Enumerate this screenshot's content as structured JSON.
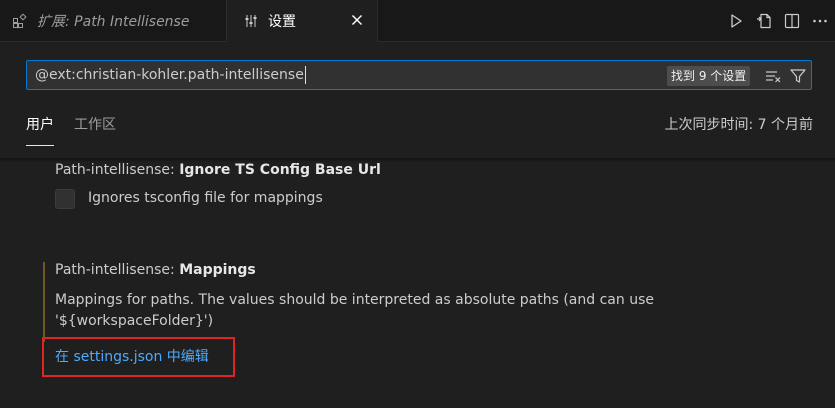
{
  "tabs": {
    "extension": {
      "label": "扩展: Path Intellisense",
      "icon": "extensions-icon"
    },
    "settings": {
      "label": "设置",
      "icon": "settings-sliders-icon",
      "close_icon": "close-icon"
    }
  },
  "editor_actions": [
    {
      "icon": "run-icon"
    },
    {
      "icon": "open-settings-json-icon"
    },
    {
      "icon": "split-editor-icon"
    },
    {
      "icon": "more-actions-icon"
    }
  ],
  "search": {
    "value": "@ext:christian-kohler.path-intellisense",
    "result_count": "找到 9 个设置",
    "clear_icon": "clear-filter-icon",
    "filter_icon": "filter-icon"
  },
  "scope_tabs": [
    {
      "label": "用户",
      "active": true
    },
    {
      "label": "工作区",
      "active": false
    }
  ],
  "sync_status": "上次同步时间: 7 个月前",
  "settings": [
    {
      "category": "Path-intellisense: ",
      "name": "Ignore TS Config Base Url",
      "checkbox_label": "Ignores tsconfig file for mappings",
      "checked": false
    },
    {
      "category": "Path-intellisense: ",
      "name": "Mappings",
      "description": "Mappings for paths. The values should be interpreted as absolute paths (and can use '${workspaceFolder}')",
      "edit_link": "在 settings.json 中编辑"
    }
  ],
  "colors": {
    "background": "#1f1f1f",
    "focus_border": "#0078d4",
    "link": "#4daafc",
    "highlight_box": "#e02424"
  }
}
